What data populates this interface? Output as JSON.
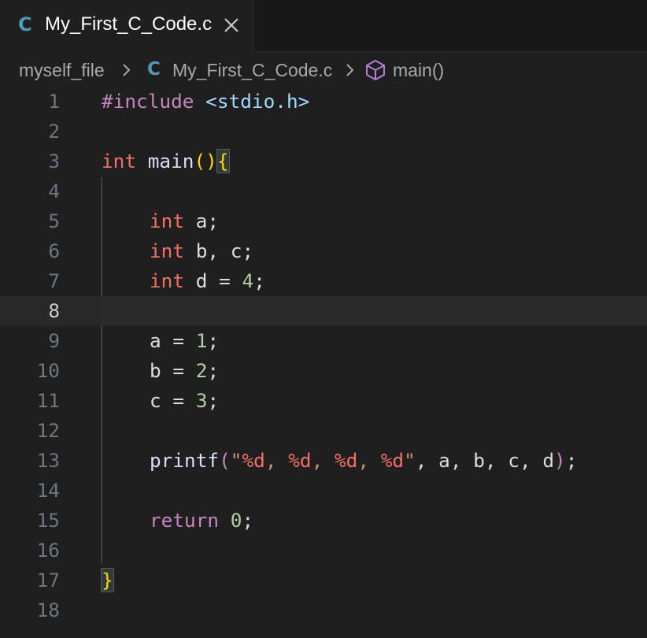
{
  "tab": {
    "language_badge": "C",
    "filename": "My_First_C_Code.c",
    "close_icon": "close-icon"
  },
  "breadcrumb": {
    "folder": "myself_file",
    "file_badge": "C",
    "file": "My_First_C_Code.c",
    "symbol_icon": "cube-icon",
    "symbol": "main()"
  },
  "editor": {
    "current_line": 8,
    "lines": [
      {
        "n": "1"
      },
      {
        "n": "2"
      },
      {
        "n": "3"
      },
      {
        "n": "4"
      },
      {
        "n": "5"
      },
      {
        "n": "6"
      },
      {
        "n": "7"
      },
      {
        "n": "8"
      },
      {
        "n": "9"
      },
      {
        "n": "10"
      },
      {
        "n": "11"
      },
      {
        "n": "12"
      },
      {
        "n": "13"
      },
      {
        "n": "14"
      },
      {
        "n": "15"
      },
      {
        "n": "16"
      },
      {
        "n": "17"
      },
      {
        "n": "18"
      }
    ],
    "code": {
      "l1_directive": "#include",
      "l1_header": " <stdio.h>",
      "l3_type": "int",
      "l3_fn": " main",
      "l3_paren": "()",
      "l3_brace": "{",
      "l5_type": "int",
      "l5_rest": " a;",
      "l6_type": "int",
      "l6_rest": " b, c;",
      "l7_type": "int",
      "l7_rest": " d = ",
      "l7_num": "4",
      "l7_semi": ";",
      "l9_var": "a = ",
      "l9_num": "1",
      "l9_semi": ";",
      "l10_var": "b = ",
      "l10_num": "2",
      "l10_semi": ";",
      "l11_var": "c = ",
      "l11_num": "3",
      "l11_semi": ";",
      "l13_fn": "printf",
      "l13_open": "(",
      "l13_q1": "\"",
      "l13_f1": "%d",
      "l13_s1": ", ",
      "l13_f2": "%d",
      "l13_s2": ", ",
      "l13_f3": "%d",
      "l13_s3": ", ",
      "l13_f4": "%d",
      "l13_q2": "\"",
      "l13_args": ", a, b, c, d",
      "l13_close": ")",
      "l13_semi": ";",
      "l15_kw": "return",
      "l15_sp": " ",
      "l15_num": "0",
      "l15_semi": ";",
      "l17_brace": "}"
    }
  },
  "colors": {
    "background": "#1f1f1f",
    "tab_bar": "#181818",
    "c_badge": "#519aba",
    "keyword": "#f47067",
    "preprocessor": "#c586c0",
    "number": "#b5cea8",
    "string": "#ce9178",
    "bracket": "#ffd700"
  }
}
